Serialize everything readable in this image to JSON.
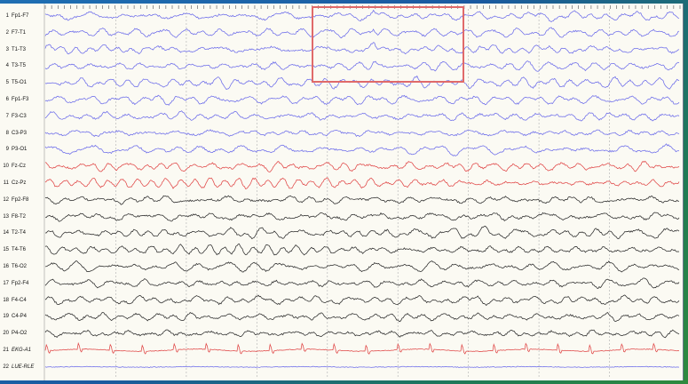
{
  "chart_data": {
    "type": "line",
    "title": "",
    "xlabel": "",
    "ylabel": "",
    "grid": true,
    "time_divisions": 9,
    "highlight_region": {
      "start_division": 3.85,
      "end_division": 6.0,
      "channels": [
        "1",
        "4"
      ]
    },
    "colors": {
      "blue": "#6b6bea",
      "red": "#e04545",
      "black": "#2a2a2a",
      "highlight": "#e06a6a"
    },
    "channels": [
      {
        "number": "1",
        "name": "Fp1-F7",
        "color": "blue"
      },
      {
        "number": "2",
        "name": "F7-T1",
        "color": "blue"
      },
      {
        "number": "3",
        "name": "T1-T3",
        "color": "blue"
      },
      {
        "number": "4",
        "name": "T3-T5",
        "color": "blue"
      },
      {
        "number": "5",
        "name": "T5-O1",
        "color": "blue"
      },
      {
        "number": "6",
        "name": "Fp1-F3",
        "color": "blue"
      },
      {
        "number": "7",
        "name": "F3-C3",
        "color": "blue"
      },
      {
        "number": "8",
        "name": "C3-P3",
        "color": "blue"
      },
      {
        "number": "9",
        "name": "P3-O1",
        "color": "blue"
      },
      {
        "number": "10",
        "name": "Fz-Cz",
        "color": "red"
      },
      {
        "number": "11",
        "name": "Cz-Pz",
        "color": "red"
      },
      {
        "number": "12",
        "name": "Fp2-F8",
        "color": "black"
      },
      {
        "number": "13",
        "name": "F8-T2",
        "color": "black"
      },
      {
        "number": "14",
        "name": "T2-T4",
        "color": "black"
      },
      {
        "number": "15",
        "name": "T4-T6",
        "color": "black"
      },
      {
        "number": "16",
        "name": "T6-O2",
        "color": "black"
      },
      {
        "number": "17",
        "name": "Fp2-F4",
        "color": "black"
      },
      {
        "number": "18",
        "name": "F4-C4",
        "color": "black"
      },
      {
        "number": "19",
        "name": "C4-P4",
        "color": "black"
      },
      {
        "number": "20",
        "name": "P4-O2",
        "color": "black"
      },
      {
        "number": "21",
        "name": "EKG-A1",
        "color": "red",
        "italic": true
      },
      {
        "number": "22",
        "name": "LUE-RLE",
        "color": "blue",
        "italic": true
      }
    ]
  }
}
